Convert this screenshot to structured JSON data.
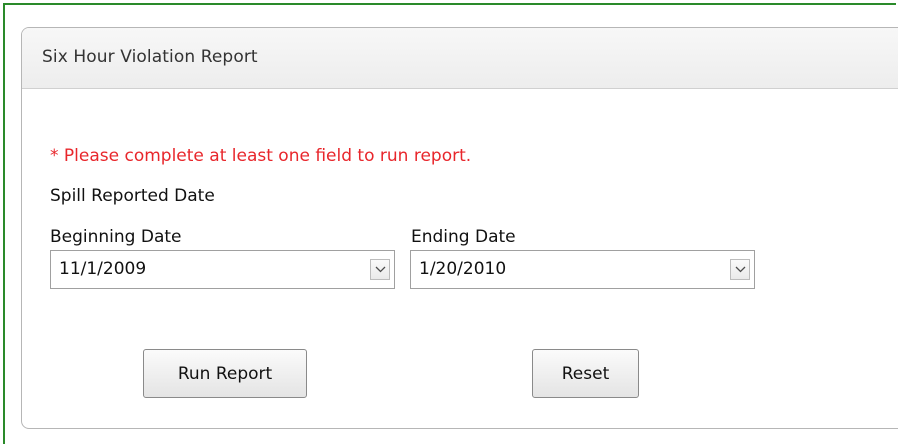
{
  "panel": {
    "title": "Six Hour Violation Report"
  },
  "form": {
    "error_message": "* Please complete at least one field to run report.",
    "section_label": "Spill Reported Date",
    "beginning_date": {
      "label": "Beginning Date",
      "value": "11/1/2009",
      "icon": "chevron-down-icon"
    },
    "ending_date": {
      "label": "Ending Date",
      "value": "1/20/2010",
      "icon": "chevron-down-icon"
    }
  },
  "buttons": {
    "run_report": "Run Report",
    "reset": "Reset"
  },
  "colors": {
    "frame_border": "#2a8a2a",
    "error_text": "#e8262b",
    "panel_border": "#b6b6b6"
  }
}
